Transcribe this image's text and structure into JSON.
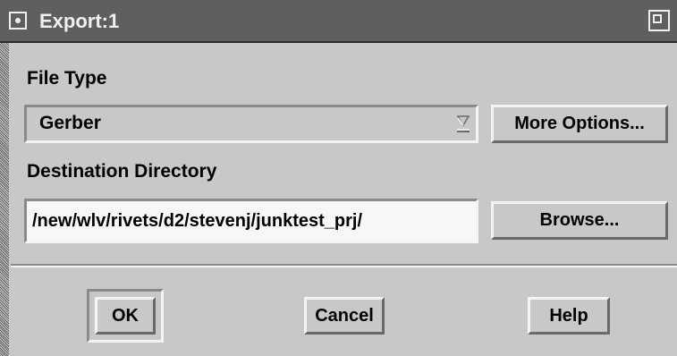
{
  "window": {
    "title": "Export:1",
    "icons": {
      "menu": "window-menu-icon",
      "maximize": "window-maximize-icon"
    }
  },
  "file_type": {
    "label": "File Type",
    "selected": "Gerber",
    "more_options_label": "More Options..."
  },
  "destination": {
    "label": "Destination Directory",
    "value": "/new/wlv/rivets/d2/stevenj/junktest_prj/",
    "browse_label": "Browse..."
  },
  "actions": {
    "ok_label": "OK",
    "cancel_label": "Cancel",
    "help_label": "Help"
  },
  "colors": {
    "background": "#c8c8c8",
    "titlebar": "#5f5f5f",
    "title_text": "#f0f0f0",
    "input_background": "#f7f7f7"
  }
}
